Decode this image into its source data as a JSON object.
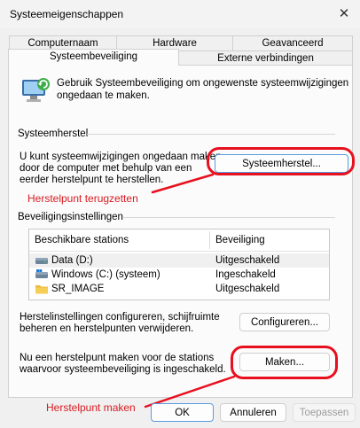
{
  "window": {
    "title": "Systeemeigenschappen",
    "close_glyph": "✕"
  },
  "tabs": {
    "row1": [
      "Computernaam",
      "Hardware",
      "Geavanceerd"
    ],
    "row2": [
      "Systeembeveiliging",
      "Externe verbindingen"
    ],
    "active": "Systeembeveiliging"
  },
  "intro": {
    "text_line1": "Gebruik Systeembeveiliging om ongewenste systeemwijzigingen",
    "text_line2": "ongedaan te maken.",
    "icon": "system-protection-icon"
  },
  "restore": {
    "group_label": "Systeemherstel",
    "desc_line1": "U kunt systeemwijzigingen ongedaan maken",
    "desc_line2": "door de computer met behulp van een",
    "desc_line3": "eerder herstelpunt te herstellen.",
    "button": "Systeemherstel..."
  },
  "protection": {
    "group_label": "Beveiligingsinstellingen",
    "columns": [
      "Beschikbare stations",
      "Beveiliging"
    ],
    "rows": [
      {
        "station": "Data (D:)",
        "status": "Uitgeschakeld",
        "icon": "drive-icon"
      },
      {
        "station": "Windows (C:) (systeem)",
        "status": "Ingeschakeld",
        "icon": "windows-drive-icon"
      },
      {
        "station": "SR_IMAGE",
        "status": "Uitgeschakeld",
        "icon": "folder-icon"
      }
    ]
  },
  "configure": {
    "desc_line1": "Herstelinstellingen configureren, schijfruimte",
    "desc_line2": "beheren en herstelpunten verwijderen.",
    "button": "Configureren..."
  },
  "create": {
    "desc_line1": "Nu een herstelpunt maken voor de stations",
    "desc_line2": "waarvoor systeembeveiliging is ingeschakeld.",
    "button": "Maken..."
  },
  "annotations": {
    "restore_label": "Herstelpunt terugzetten",
    "create_label": "Herstelpunt maken",
    "color": "#e8101e"
  },
  "footer": {
    "ok": "OK",
    "cancel": "Annuleren",
    "apply": "Toepassen"
  }
}
